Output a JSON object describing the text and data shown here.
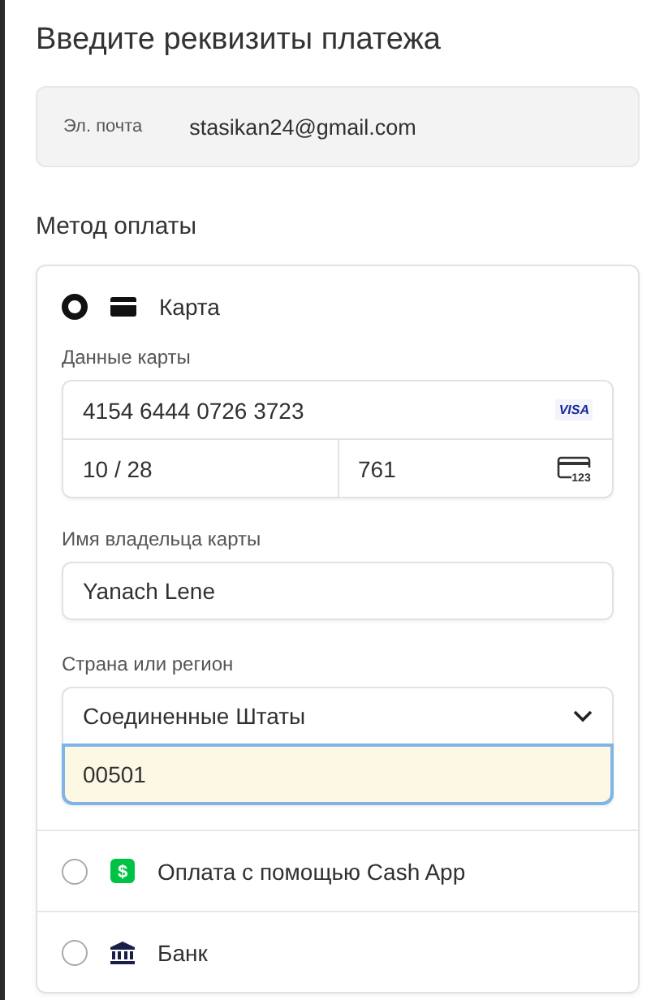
{
  "title": "Введите реквизиты платежа",
  "email": {
    "label": "Эл. почта",
    "value": "stasikan24@gmail.com"
  },
  "payment_method": {
    "heading": "Метод оплаты",
    "methods": [
      {
        "kind": "card",
        "label": "Карта",
        "selected": true
      },
      {
        "kind": "cashapp",
        "label": "Оплата с помощью Cash App",
        "icon_text": "$",
        "selected": false
      },
      {
        "kind": "bank",
        "label": "Банк",
        "selected": false
      }
    ],
    "card_form": {
      "card_label": "Данные карты",
      "number": "4154 6444 0726 3723",
      "brand": "VISA",
      "expiry": "10 / 28",
      "cvc": "761",
      "cvc_icon_text": "123",
      "name_label": "Имя владельца карты",
      "name": "Yanach Lene",
      "country_label": "Страна или регион",
      "country": "Соединенные Штаты",
      "zip": "00501",
      "zip_focused": true
    }
  }
}
